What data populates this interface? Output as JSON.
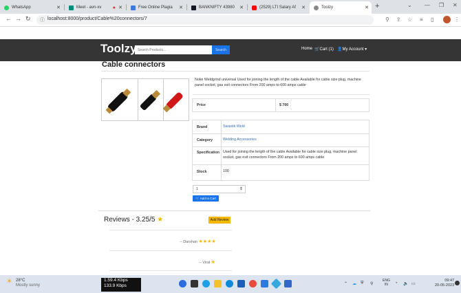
{
  "browser": {
    "tabs": [
      {
        "label": "WhatsApp",
        "favicon_color": "#25d366",
        "active": false
      },
      {
        "label": "Meet - avn-xv",
        "favicon_color": "#00897b",
        "active": false
      },
      {
        "label": "Free Online Plagia",
        "favicon_color": "#3b7dd8",
        "active": false
      },
      {
        "label": "BANKNIFTY 43980",
        "favicon_color": "#131722",
        "active": false
      },
      {
        "label": "(2529) LTI Salary Af",
        "favicon_color": "#ff0000",
        "active": false
      },
      {
        "label": "Toolzy",
        "favicon_color": "#888888",
        "active": true
      }
    ],
    "new_tab_icon": "plus-icon",
    "url": "localhost:8000/product/Cable%20connectors/7"
  },
  "site": {
    "brand": "Toolzy",
    "search_placeholder": "Search Products...",
    "search_button": "Search",
    "nav": {
      "home": "Home",
      "cart": "Cart (1)",
      "account": "My Account"
    }
  },
  "product": {
    "title": "Cable connectors",
    "description": "Noke Weldgrind universal Used for joining the length of the cable Available for cable size plug, machine panel socket, gas exit connectors From 200 amps to 600 amps cable",
    "price_label": "Price",
    "price_value": "$ 700",
    "details": [
      {
        "label": "Brand",
        "value": "Swastik Weld"
      },
      {
        "label": "Category",
        "value": "Welding Accessories"
      },
      {
        "label": "Specification",
        "value": "Used for joining the length of the cable Available for cable size plug, machine panel socket, gas exit connectors From 200 amps to 600 amps cable"
      },
      {
        "label": "Stock",
        "value": "100"
      }
    ],
    "quantity": "1",
    "add_to_cart": "Add to Cart"
  },
  "reviews": {
    "title": "Reviews - 3.25/5",
    "add_review": "Add Review",
    "items": [
      {
        "author": "-- Darshan",
        "stars": 4
      },
      {
        "author": "-- Viral",
        "stars": 1
      }
    ]
  },
  "taskbar": {
    "temperature": "28°C",
    "weather": "Mostly sunny",
    "upload": "1.59.4 Kbps",
    "download": "133.9 Kbps",
    "lang": "ENG",
    "region": "IN",
    "time": "09:47",
    "date": "20-05-2023"
  }
}
